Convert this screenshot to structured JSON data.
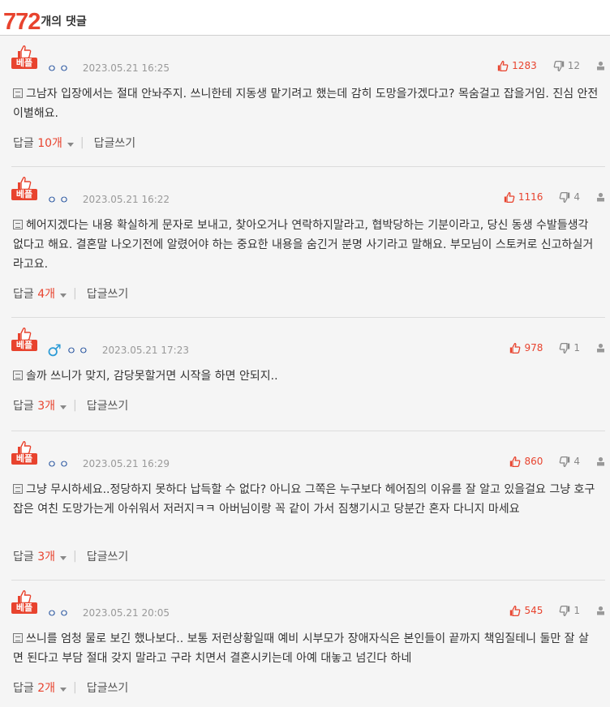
{
  "header": {
    "count": "772",
    "label": "개의 댓글"
  },
  "icons": {
    "thumb_up": "thumbs-up-icon",
    "thumb_down": "thumbs-down-icon",
    "report": "report-icon",
    "memo": "memo-icon"
  },
  "colors": {
    "accent": "#e8432e",
    "username": "#1f4e9c",
    "gender": "#2c9bd6"
  },
  "comments": [
    {
      "badge": "베플",
      "user": "ㅇㅇ",
      "date": "2023.05.21 16:25",
      "up": "1283",
      "down": "12",
      "text": "그남자 입장에서는 절대 안놔주지. 쓰니한테 지동생 맡기려고 했는데 감히 도망을가겠다고? 목숨걸고 잡을거임. 진심 안전이별해요.",
      "reply_label": "답글",
      "reply_count": "10개",
      "write_label": "답글쓰기"
    },
    {
      "badge": "베플",
      "user": "ㅇㅇ",
      "date": "2023.05.21 16:22",
      "up": "1116",
      "down": "4",
      "text": "헤어지겠다는 내용 확실하게 문자로 보내고, 찾아오거나 연락하지말라고, 협박당하는 기분이라고, 당신 동생 수발들생각 없다고 해요. 결혼말 나오기전에 알렸어야 하는 중요한 내용을 숨긴거 분명 사기라고 말해요. 부모님이 스토커로 신고하실거라고요.",
      "reply_label": "답글",
      "reply_count": "4개",
      "write_label": "답글쓰기"
    },
    {
      "badge": "베플",
      "gender": "♂",
      "user": "ㅇㅇ",
      "date": "2023.05.21 17:23",
      "up": "978",
      "down": "1",
      "text": "솔까 쓰니가 맞지, 감당못할거면 시작을 하면 안되지..",
      "reply_label": "답글",
      "reply_count": "3개",
      "write_label": "답글쓰기"
    },
    {
      "badge": "베플",
      "user": "ㅇㅇ",
      "date": "2023.05.21 16:29",
      "up": "860",
      "down": "4",
      "text": "그냥 무시하세요..정당하지 못하다 납득할 수 없다? 아니요 그쪽은 누구보다 헤어짐의 이유를 잘 알고 있을걸요 그냥 호구잡은 여친 도망가는게 아쉬워서 저러지ㅋㅋ 아버님이랑 꼭 같이 가서 짐챙기시고 당분간 혼자 다니지 마세요",
      "reply_label": "답글",
      "reply_count": "3개",
      "write_label": "답글쓰기"
    },
    {
      "badge": "베플",
      "user": "ㅇㅇ",
      "date": "2023.05.21 20:05",
      "up": "545",
      "down": "1",
      "text": "쓰니를 엄청 물로 보긴 했나보다.. 보통 저런상황일때 예비 시부모가 장애자식은 본인들이 끝까지 책임질테니 둘만 잘 살면 된다고 부담 절대 갖지 말라고 구라 치면서 결혼시키는데 아예 대놓고 넘긴다 하네",
      "reply_label": "답글",
      "reply_count": "2개",
      "write_label": "답글쓰기"
    }
  ]
}
